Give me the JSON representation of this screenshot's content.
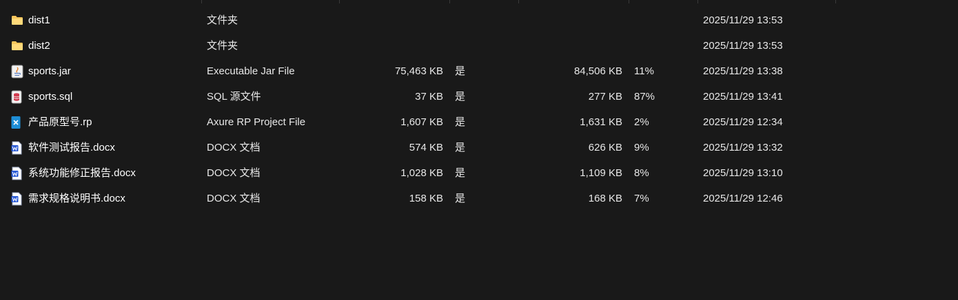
{
  "colors": {
    "background": "#191919",
    "text": "#ffffff",
    "folder": "#f7c55c",
    "sql": "#d23b4f",
    "axure": "#1e8ed6",
    "word": "#2a5bd6",
    "java": "#e47b20"
  },
  "files": [
    {
      "icon": "folder-icon",
      "name": "dist1",
      "type": "文件夹",
      "size": "",
      "flag": "",
      "compressed_size": "",
      "ratio": "",
      "modified": "2025/11/29 13:53"
    },
    {
      "icon": "folder-icon",
      "name": "dist2",
      "type": "文件夹",
      "size": "",
      "flag": "",
      "compressed_size": "",
      "ratio": "",
      "modified": "2025/11/29 13:53"
    },
    {
      "icon": "java-jar-icon",
      "name": "sports.jar",
      "type": "Executable Jar File",
      "size": "75,463 KB",
      "flag": "是",
      "compressed_size": "84,506 KB",
      "ratio": "11%",
      "modified": "2025/11/29 13:38"
    },
    {
      "icon": "sql-file-icon",
      "name": "sports.sql",
      "type": "SQL 源文件",
      "size": "37 KB",
      "flag": "是",
      "compressed_size": "277 KB",
      "ratio": "87%",
      "modified": "2025/11/29 13:41"
    },
    {
      "icon": "axure-file-icon",
      "name": "产品原型号.rp",
      "type": "Axure RP Project File",
      "size": "1,607 KB",
      "flag": "是",
      "compressed_size": "1,631 KB",
      "ratio": "2%",
      "modified": "2025/11/29 12:34"
    },
    {
      "icon": "word-doc-icon",
      "name": "软件测试报告.docx",
      "type": "DOCX 文档",
      "size": "574 KB",
      "flag": "是",
      "compressed_size": "626 KB",
      "ratio": "9%",
      "modified": "2025/11/29 13:32"
    },
    {
      "icon": "word-doc-icon",
      "name": "系统功能修正报告.docx",
      "type": "DOCX 文档",
      "size": "1,028 KB",
      "flag": "是",
      "compressed_size": "1,109 KB",
      "ratio": "8%",
      "modified": "2025/11/29 13:10"
    },
    {
      "icon": "word-doc-icon",
      "name": "需求规格说明书.docx",
      "type": "DOCX 文档",
      "size": "158 KB",
      "flag": "是",
      "compressed_size": "168 KB",
      "ratio": "7%",
      "modified": "2025/11/29 12:46"
    }
  ]
}
